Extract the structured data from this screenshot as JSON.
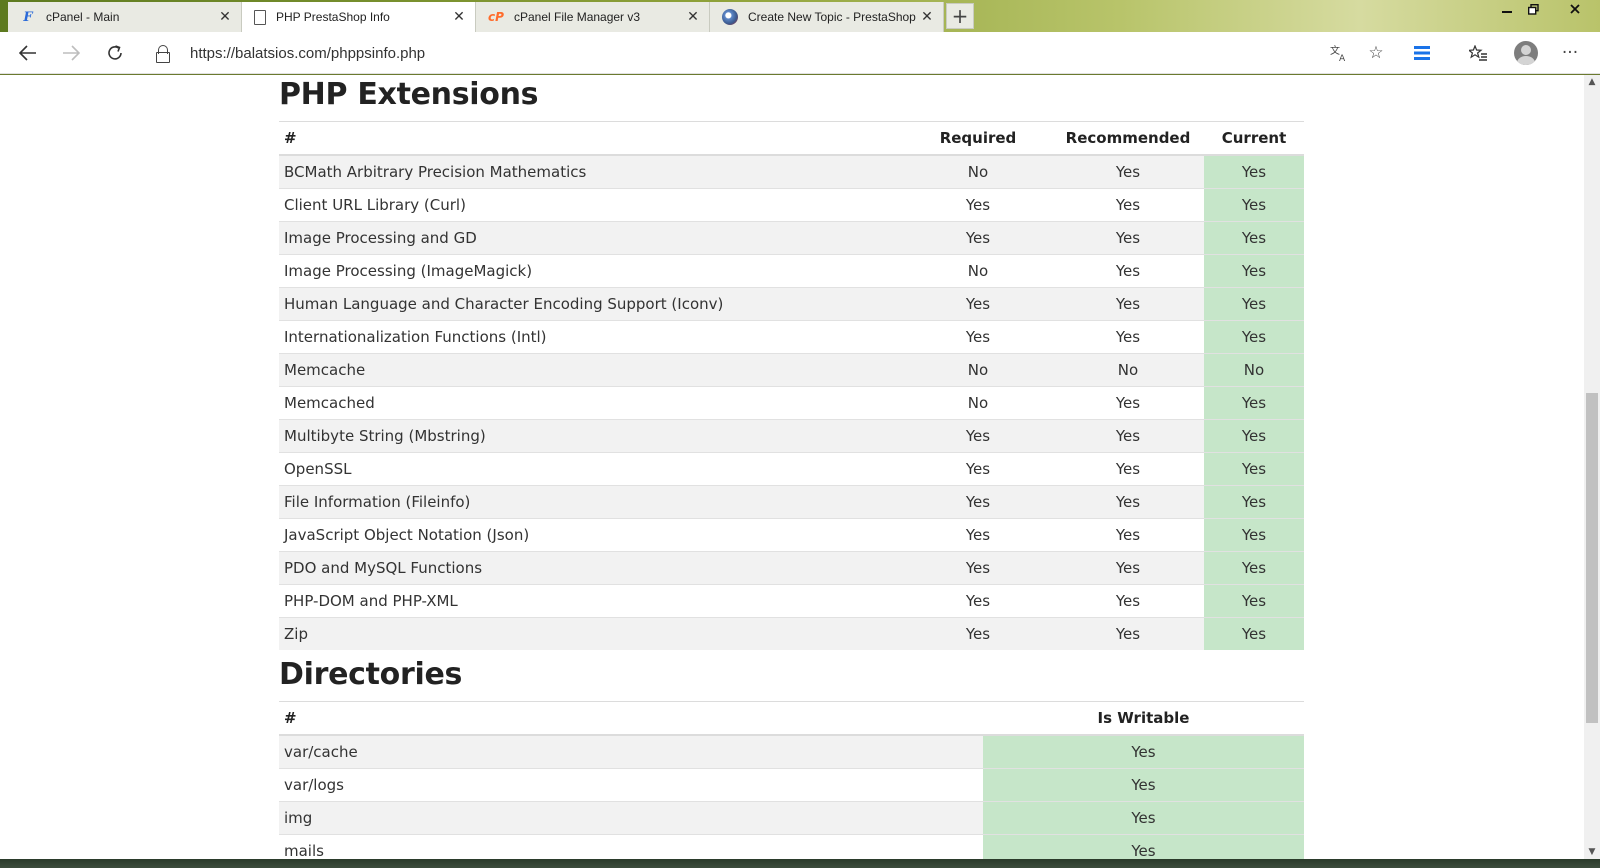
{
  "tabs": [
    {
      "title": "cPanel - Main",
      "icon": "cpanel-f-icon",
      "active": false
    },
    {
      "title": "PHP PrestaShop Info",
      "icon": "page-icon",
      "active": true
    },
    {
      "title": "cPanel File Manager v3",
      "icon": "cpanel-cp-icon",
      "active": false
    },
    {
      "title": "Create New Topic - PrestaShop F",
      "icon": "prestashop-icon",
      "active": false
    }
  ],
  "address_bar": {
    "url": "https://balatsios.com/phppsinfo.php"
  },
  "extensions": {
    "title": "PHP Extensions",
    "headers": [
      "#",
      "Required",
      "Recommended",
      "Current"
    ],
    "rows": [
      {
        "name": "BCMath Arbitrary Precision Mathematics",
        "required": "No",
        "recommended": "Yes",
        "current": "Yes"
      },
      {
        "name": "Client URL Library (Curl)",
        "required": "Yes",
        "recommended": "Yes",
        "current": "Yes"
      },
      {
        "name": "Image Processing and GD",
        "required": "Yes",
        "recommended": "Yes",
        "current": "Yes"
      },
      {
        "name": "Image Processing (ImageMagick)",
        "required": "No",
        "recommended": "Yes",
        "current": "Yes"
      },
      {
        "name": "Human Language and Character Encoding Support (Iconv)",
        "required": "Yes",
        "recommended": "Yes",
        "current": "Yes"
      },
      {
        "name": "Internationalization Functions (Intl)",
        "required": "Yes",
        "recommended": "Yes",
        "current": "Yes"
      },
      {
        "name": "Memcache",
        "required": "No",
        "recommended": "No",
        "current": "No"
      },
      {
        "name": "Memcached",
        "required": "No",
        "recommended": "Yes",
        "current": "Yes"
      },
      {
        "name": "Multibyte String (Mbstring)",
        "required": "Yes",
        "recommended": "Yes",
        "current": "Yes"
      },
      {
        "name": "OpenSSL",
        "required": "Yes",
        "recommended": "Yes",
        "current": "Yes"
      },
      {
        "name": "File Information (Fileinfo)",
        "required": "Yes",
        "recommended": "Yes",
        "current": "Yes"
      },
      {
        "name": "JavaScript Object Notation (Json)",
        "required": "Yes",
        "recommended": "Yes",
        "current": "Yes"
      },
      {
        "name": "PDO and MySQL Functions",
        "required": "Yes",
        "recommended": "Yes",
        "current": "Yes"
      },
      {
        "name": "PHP-DOM and PHP-XML",
        "required": "Yes",
        "recommended": "Yes",
        "current": "Yes"
      },
      {
        "name": "Zip",
        "required": "Yes",
        "recommended": "Yes",
        "current": "Yes"
      }
    ]
  },
  "directories": {
    "title": "Directories",
    "headers": [
      "#",
      "Is Writable"
    ],
    "rows": [
      {
        "name": "var/cache",
        "writable": "Yes"
      },
      {
        "name": "var/logs",
        "writable": "Yes"
      },
      {
        "name": "img",
        "writable": "Yes"
      },
      {
        "name": "mails",
        "writable": "Yes"
      }
    ]
  },
  "colors": {
    "ok_cell": "#c6e6c9",
    "stripe": "#f2f2f2"
  }
}
